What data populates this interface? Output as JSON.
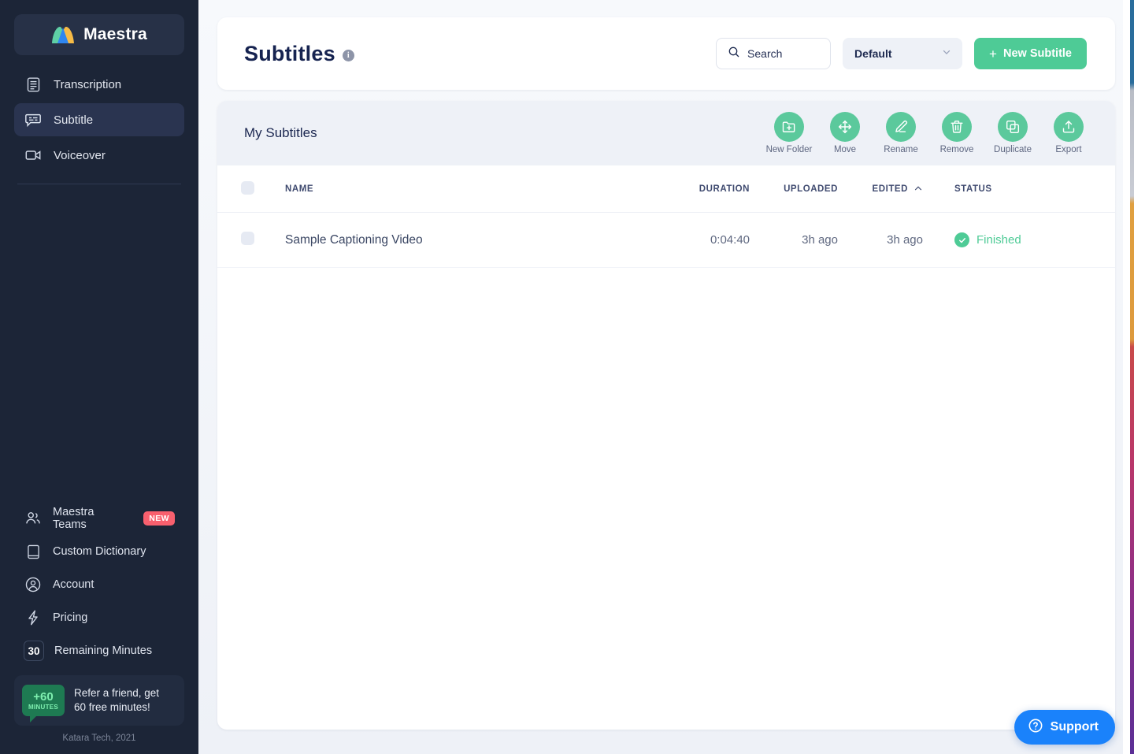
{
  "sidebar": {
    "brand": {
      "name": "Maestra",
      "icon": "maestra-logo-icon"
    },
    "nav": [
      {
        "label": "Transcription",
        "icon": "document-lines-icon",
        "active": false
      },
      {
        "label": "Subtitle",
        "icon": "subtitle-bubble-icon",
        "active": true
      },
      {
        "label": "Voiceover",
        "icon": "video-camera-icon",
        "active": false
      }
    ],
    "bottom_nav": [
      {
        "label": "Maestra Teams",
        "icon": "users-icon",
        "badge": "NEW"
      },
      {
        "label": "Custom Dictionary",
        "icon": "book-icon",
        "badge": ""
      },
      {
        "label": "Account",
        "icon": "user-circle-icon",
        "badge": ""
      },
      {
        "label": "Pricing",
        "icon": "lightning-bolt-icon",
        "badge": ""
      }
    ],
    "remaining": {
      "count": "30",
      "label": "Remaining Minutes"
    },
    "referral": {
      "badge_top": "+60",
      "badge_bottom": "MINUTES",
      "line1": "Refer a friend, get",
      "line2": "60 free minutes!"
    },
    "copyright": "Katara Tech, 2021"
  },
  "header": {
    "title": "Subtitles",
    "info_icon": "info-icon",
    "info_glyph": "i",
    "search": {
      "label": "Search",
      "placeholder": "Search",
      "icon": "search-icon"
    },
    "dropdown": {
      "selected": "Default",
      "icon": "chevron-down-icon"
    },
    "new_button": {
      "label": "New Subtitle",
      "plus": "+"
    }
  },
  "toolbar": {
    "title": "My Subtitles",
    "tools": [
      {
        "label": "New Folder",
        "icon": "folder-plus-icon"
      },
      {
        "label": "Move",
        "icon": "move-arrows-icon"
      },
      {
        "label": "Rename",
        "icon": "pencil-icon"
      },
      {
        "label": "Remove",
        "icon": "trash-icon"
      },
      {
        "label": "Duplicate",
        "icon": "copy-icon"
      },
      {
        "label": "Export",
        "icon": "upload-box-icon"
      }
    ]
  },
  "table": {
    "columns": {
      "name": "NAME",
      "duration": "DURATION",
      "uploaded": "UPLOADED",
      "edited": "EDITED",
      "status": "STATUS"
    },
    "sort": {
      "column": "EDITED",
      "direction": "asc",
      "icon": "chevron-up-icon"
    },
    "rows": [
      {
        "name": "Sample Captioning Video",
        "duration": "0:04:40",
        "uploaded": "3h ago",
        "edited": "3h ago",
        "status": "Finished",
        "status_icon": "check-circle-icon"
      }
    ]
  },
  "support": {
    "label": "Support",
    "icon": "question-circle-icon"
  },
  "colors": {
    "sidebar_bg": "#1c2537",
    "accent_green": "#4ecb96",
    "tool_green": "#5bc99c",
    "support_blue": "#1a82fb",
    "badge_red": "#f8606e",
    "title_navy": "#162350"
  }
}
